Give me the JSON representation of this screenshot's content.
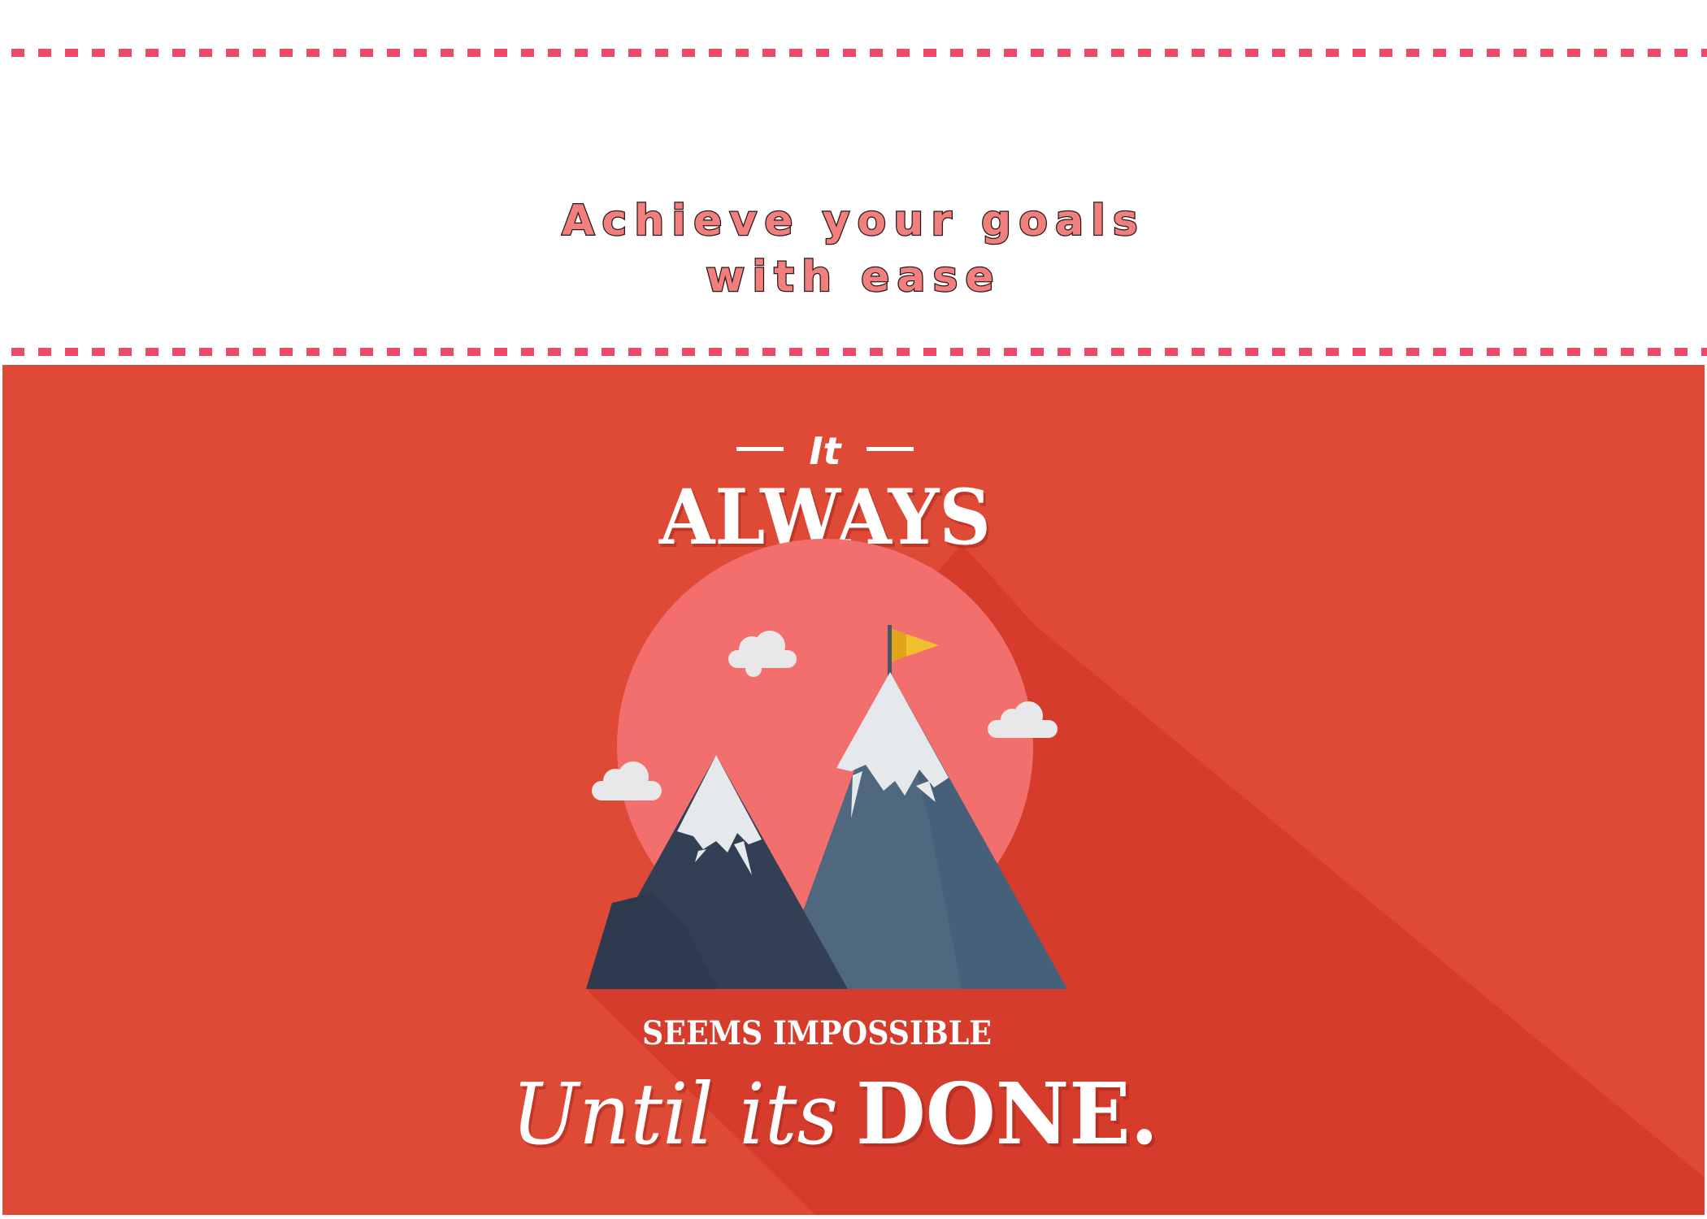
{
  "header": {
    "title_line_1": "Achieve your goals",
    "title_line_2": "with ease"
  },
  "poster": {
    "line_it": "It",
    "line_always": "ALWAYS",
    "line_seems": "SEEMS IMPOSSIBLE",
    "line_until": "Until its",
    "line_done": "DONE."
  },
  "colors": {
    "dash_line": "#ec4a68",
    "title_fill": "#f07f7d",
    "poster_bg": "#df4a36",
    "sun_circle": "#f36f6d",
    "mountain_dark": "#333f55",
    "mountain_light": "#4f677f",
    "snow": "#e6e9ec",
    "flag": "#f0c02e"
  },
  "icons": [
    "mountain-peaks-illustration",
    "flag-icon",
    "cloud-icon"
  ]
}
